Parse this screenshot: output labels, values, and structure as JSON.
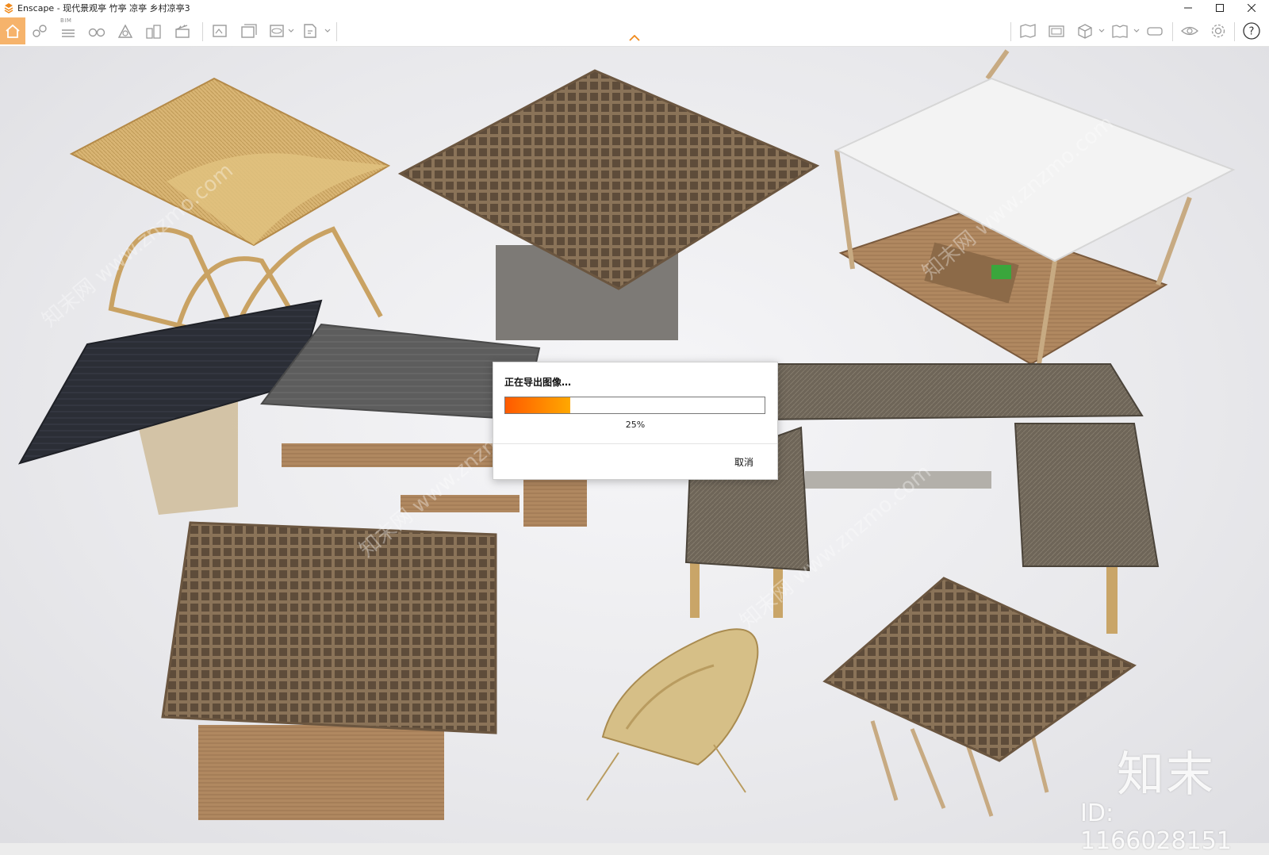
{
  "window": {
    "title": "Enscape - 现代景观亭 竹亭 凉亭 乡村凉亭3",
    "controls": [
      "minimize-icon",
      "maximize-icon",
      "close-icon"
    ]
  },
  "toolbar": {
    "bim_label": "BIM",
    "left_icons": [
      "home-icon",
      "asset-library-icon",
      "bim-icon",
      "binoculars-icon",
      "site-context-icon",
      "buildings-icon",
      "clapboard-icon",
      "render-image-icon",
      "batch-render-icon",
      "render-360-icon",
      "export-exe-icon"
    ],
    "right_icons": [
      "map-icon",
      "screenshot-icon",
      "cube-icon",
      "book-views-icon",
      "vr-headset-icon",
      "visibility-eye-icon",
      "settings-gear-icon",
      "help-icon"
    ],
    "accent_color": "#f6b36b"
  },
  "viewport": {
    "watermark_logo": "知末",
    "watermark_id": "ID: 1166028151",
    "watermark_repeat": "知末网 www.znzmo.com"
  },
  "dialog": {
    "title": "正在导出图像…",
    "progress": 0.25,
    "progress_label": "25%",
    "cancel_label": "取消",
    "bar_colors": [
      "#ff5a00",
      "#ffa800"
    ]
  }
}
